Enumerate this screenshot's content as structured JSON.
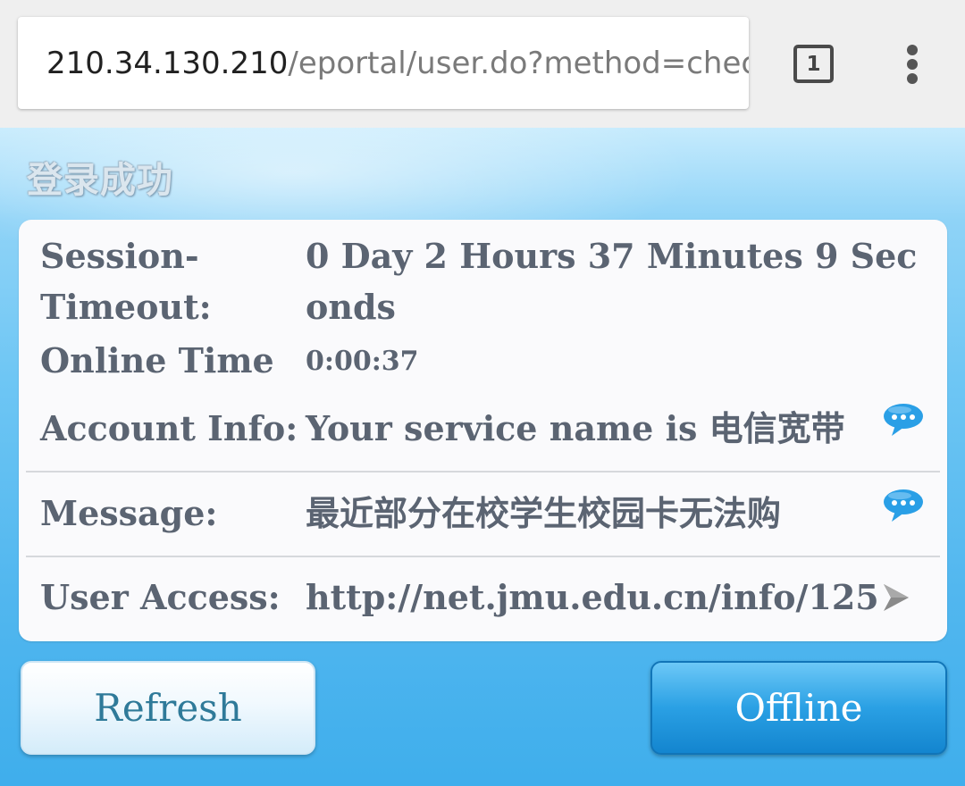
{
  "browser": {
    "url_host": "210.34.130.210",
    "url_path": "/eportal/user.do?method=check",
    "tab_count": "1",
    "menu_icon": "more-vertical-icon"
  },
  "page": {
    "title": "登录成功"
  },
  "info": {
    "session_timeout_label": "Session-Timeout:",
    "session_timeout_value": "0 Day 2 Hours 37 Minutes 9 Seconds",
    "online_time_label": "Online Time",
    "online_time_value": "0:00:37",
    "account_label": "Account Info:",
    "account_value": "Your service name is 电信宽带",
    "message_label": "Message:",
    "message_value": "最近部分在校学生校园卡无法购",
    "access_label": "User Access:",
    "access_value": "http://net.jmu.edu.cn/info/125"
  },
  "buttons": {
    "refresh": "Refresh",
    "offline": "Offline"
  },
  "colors": {
    "accent": "#2aa0e4",
    "bubble_icon": "#2a9fe6",
    "label_text": "#5b6472"
  }
}
